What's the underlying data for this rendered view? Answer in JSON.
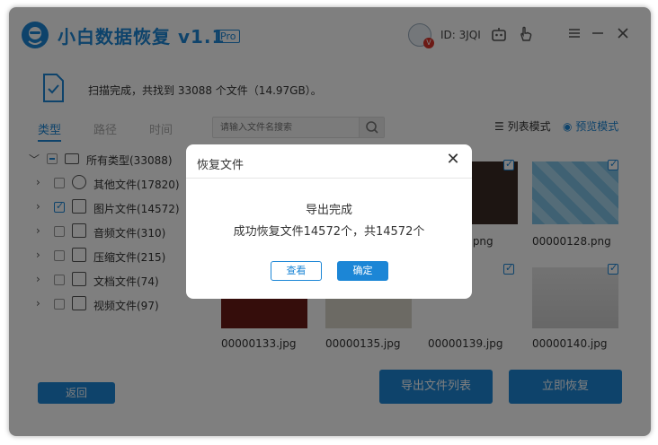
{
  "app": {
    "title": "小白数据恢复 v1.1",
    "badge": "Pro",
    "user_id": "ID: 3JQI",
    "vip_badge": "V"
  },
  "scan": {
    "summary": "扫描完成，共找到 33088 个文件（14.97GB）。"
  },
  "tabs": [
    {
      "label": "类型"
    },
    {
      "label": "路径"
    },
    {
      "label": "时间"
    }
  ],
  "search": {
    "placeholder": "请输入文件名搜索"
  },
  "view_modes": {
    "list": "列表模式",
    "preview": "预览模式"
  },
  "tree": {
    "root": "所有类型(33088)",
    "items": [
      {
        "label": "其他文件(17820)",
        "icon": "other-file-icon",
        "checked": false
      },
      {
        "label": "图片文件(14572)",
        "icon": "image-file-icon",
        "checked": true
      },
      {
        "label": "音频文件(310)",
        "icon": "audio-file-icon",
        "checked": false
      },
      {
        "label": "压缩文件(215)",
        "icon": "archive-file-icon",
        "checked": false
      },
      {
        "label": "文档文件(74)",
        "icon": "document-file-icon",
        "checked": false
      },
      {
        "label": "视频文件(97)",
        "icon": "video-file-icon",
        "checked": false
      }
    ]
  },
  "files": {
    "row1": [
      {
        "name": ".png"
      },
      {
        "name": "00000128.png"
      }
    ],
    "row2": [
      {
        "name": "00000133.jpg"
      },
      {
        "name": "00000135.jpg"
      },
      {
        "name": "00000139.jpg"
      },
      {
        "name": "00000140.jpg"
      }
    ]
  },
  "buttons": {
    "back": "返回",
    "export_list": "导出文件列表",
    "recover_now": "立即恢复"
  },
  "dialog": {
    "title": "恢复文件",
    "message_title": "导出完成",
    "message_detail": "成功恢复文件14572个，共14572个",
    "view_label": "查看",
    "ok_label": "确定"
  },
  "colors": {
    "accent": "#1c86d6",
    "overlay": "rgba(0,0,0,0.5)"
  }
}
